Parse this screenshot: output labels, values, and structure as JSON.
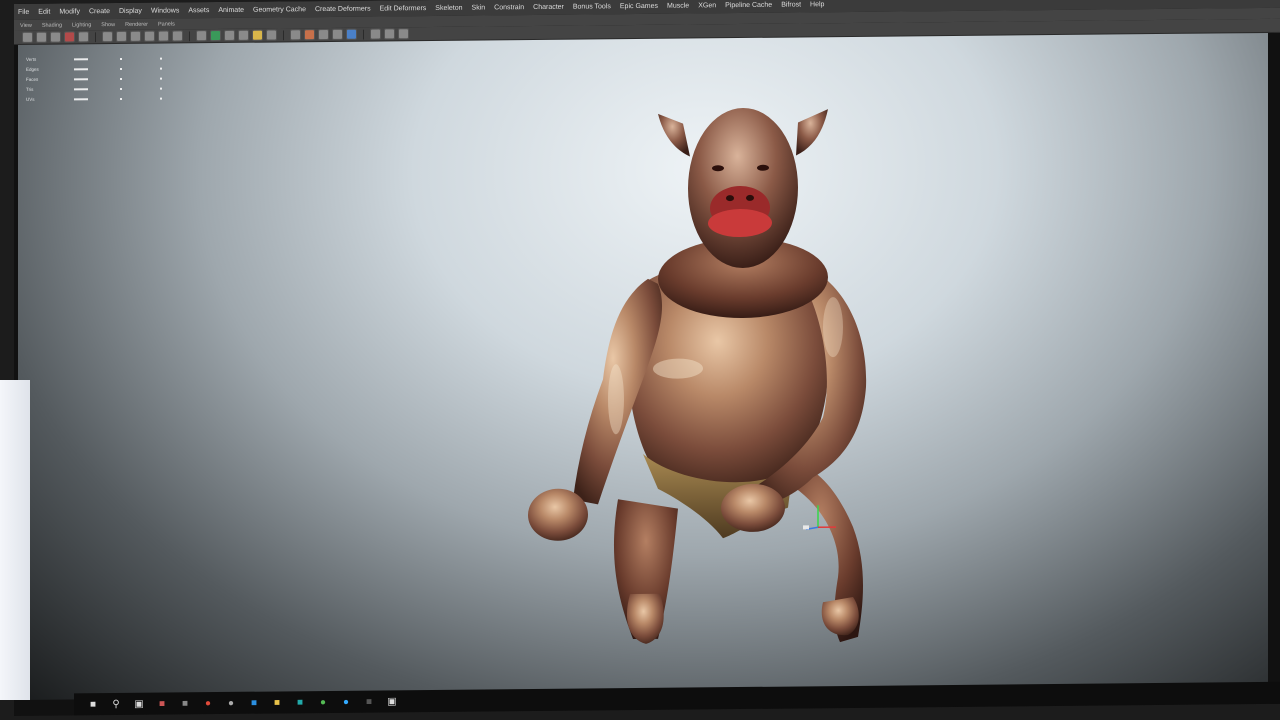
{
  "app": {
    "menu": [
      "File",
      "Edit",
      "Modify",
      "Create",
      "Display",
      "Windows",
      "Assets",
      "Animate",
      "Geometry Cache",
      "Create Deformers",
      "Edit Deformers",
      "Skeleton",
      "Skin",
      "Constrain",
      "Character",
      "Bonus Tools",
      "Epic Games",
      "Muscle",
      "XGen",
      "Pipeline Cache",
      "Bifrost",
      "Help"
    ],
    "panel_menu": [
      "View",
      "Shading",
      "Lighting",
      "Show",
      "Renderer",
      "Panels"
    ]
  },
  "hud": {
    "rows": [
      "Verts",
      "Edges",
      "Faces",
      "Tris",
      "UVs"
    ]
  },
  "colors": {
    "viewport_top": "#eef3f6",
    "viewport_bottom": "#191b1c",
    "menubar": "#3b3b3b"
  },
  "taskbar": {
    "icons": [
      "windows-start-icon",
      "search-icon",
      "task-view-icon",
      "app-icon-1",
      "app-icon-2",
      "chrome-icon",
      "app-icon-3",
      "photoshop-icon",
      "folder-icon",
      "app-icon-4",
      "app-icon-5",
      "app-icon-6",
      "app-icon-7",
      "maya-icon"
    ]
  }
}
